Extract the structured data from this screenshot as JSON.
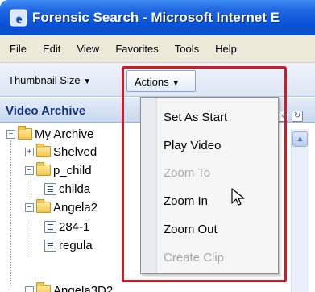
{
  "window": {
    "title": "Forensic Search - Microsoft Internet E"
  },
  "menubar": {
    "items": [
      "File",
      "Edit",
      "View",
      "Favorites",
      "Tools",
      "Help"
    ]
  },
  "toolbar": {
    "thumbnail_size_label": "Thumbnail Size",
    "actions_label": "Actions"
  },
  "panel": {
    "title": "Video Archive"
  },
  "tree": {
    "items": [
      {
        "label": "My Archive",
        "type": "folder",
        "expanded": true
      },
      {
        "label": "Shelved",
        "type": "folder",
        "expanded": false
      },
      {
        "label": "p_child",
        "type": "folder",
        "expanded": true
      },
      {
        "label": "childa",
        "type": "document"
      },
      {
        "label": "Angela2",
        "type": "folder",
        "expanded": true
      },
      {
        "label": "284-1",
        "type": "document"
      },
      {
        "label": "regula",
        "type": "document"
      },
      {
        "label": "Angela3D2",
        "type": "folder",
        "expanded": true
      }
    ]
  },
  "actions_menu": {
    "items": [
      {
        "label": "Set As Start",
        "enabled": true
      },
      {
        "label": "Play Video",
        "enabled": true
      },
      {
        "label": "Zoom To",
        "enabled": false
      },
      {
        "label": "Zoom In",
        "enabled": true
      },
      {
        "label": "Zoom Out",
        "enabled": true
      },
      {
        "label": "Create Clip",
        "enabled": false
      }
    ]
  },
  "colors": {
    "title_bar": "#0a52d6",
    "highlight": "#cf1c24",
    "disabled_text": "#a7a7a7"
  }
}
